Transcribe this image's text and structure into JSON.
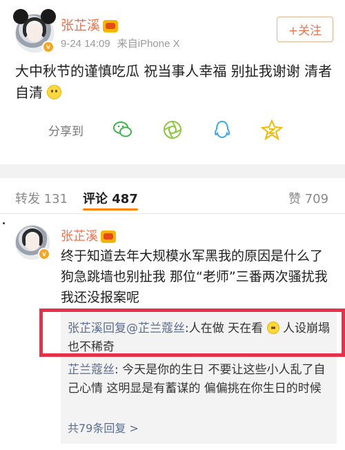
{
  "post": {
    "author": "张芷溪",
    "time": "9-24 14:09",
    "source": "来自iPhone X",
    "follow_label": "+关注",
    "text": "大中秋节的谨慎吃瓜 祝当事人幸福 别扯我谢谢 清者自清",
    "share_label": "分享到",
    "share_targets": [
      "wechat-icon",
      "moments-icon",
      "qq-icon",
      "qzone-icon"
    ]
  },
  "tabs": {
    "repost": "转发 131",
    "comments": "评论 487",
    "likes": "赞 709"
  },
  "comment": {
    "author": "张芷溪",
    "text": "终于知道去年大规模水军黑我的原因是什么了 狗急跳墙也别扯我 那位“老师”三番两次骚扰我我还没报案呢",
    "replies": [
      {
        "who": "张芷溪回复@芷兰蔻丝",
        "text": ":人在做 天在看",
        "tail": " 人设崩塌也不稀奇"
      },
      {
        "who": "芷兰蔻丝",
        "text": ": 今天是你的生日 不要让这些小人乱了自己心情 这明显是有蓄谋的 偏偏挑在你生日的时候",
        "tail": ""
      }
    ],
    "more_replies": "共79条回复 >"
  },
  "colors": {
    "name": "#eb7350",
    "link": "#5b6d8c",
    "highlight": "#e8304a",
    "tab_accent": "#ff8200"
  }
}
